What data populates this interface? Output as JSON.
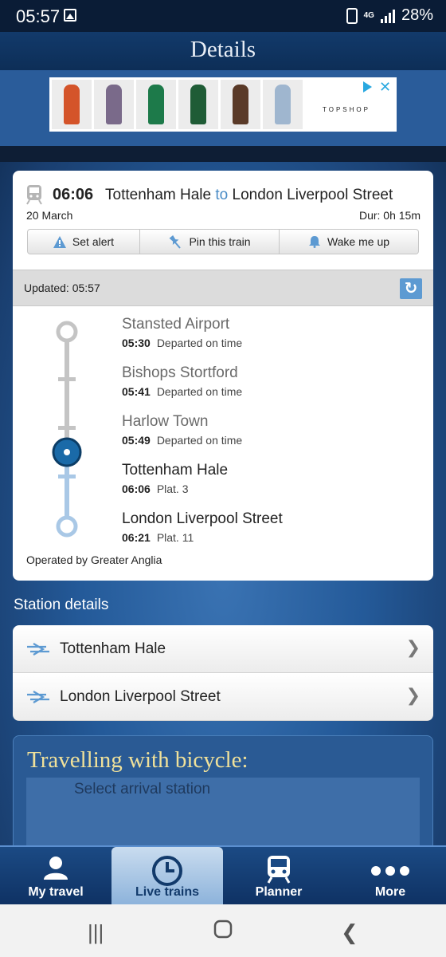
{
  "status_bar": {
    "time": "05:57",
    "network": "4G",
    "battery": "28%"
  },
  "header": {
    "title": "Details"
  },
  "ad": {
    "brand": "TOPSHOP",
    "close": "✕"
  },
  "trip": {
    "departure_time": "06:06",
    "from": "Tottenham Hale",
    "to_word": "to",
    "to": "London Liverpool Street",
    "date": "20 March",
    "duration": "Dur: 0h 15m",
    "actions": [
      "Set alert",
      "Pin this train",
      "Wake me up"
    ]
  },
  "updated": "Updated: 05:57",
  "stops": [
    {
      "name": "Stansted Airport",
      "time": "05:30",
      "status": "Departed on time"
    },
    {
      "name": "Bishops Stortford",
      "time": "05:41",
      "status": "Departed on time"
    },
    {
      "name": "Harlow Town",
      "time": "05:49",
      "status": "Departed on time"
    },
    {
      "name": "Tottenham Hale",
      "time": "06:06",
      "status": "Plat. 3"
    },
    {
      "name": "London Liverpool Street",
      "time": "06:21",
      "status": "Plat. 11"
    }
  ],
  "operated_by": "Operated by Greater Anglia",
  "station_details": {
    "title": "Station details",
    "items": [
      "Tottenham Hale",
      "London Liverpool Street"
    ]
  },
  "bicycle": {
    "title": "Travelling with bicycle:",
    "select_label": "Select arrival station"
  },
  "tabs": [
    "My travel",
    "Live trains",
    "Planner",
    "More"
  ],
  "colors": {
    "header": "#123a6b",
    "accent": "#4a8cc6",
    "current_stop": "#1a6aa8",
    "bike_title": "#f0e19a"
  }
}
